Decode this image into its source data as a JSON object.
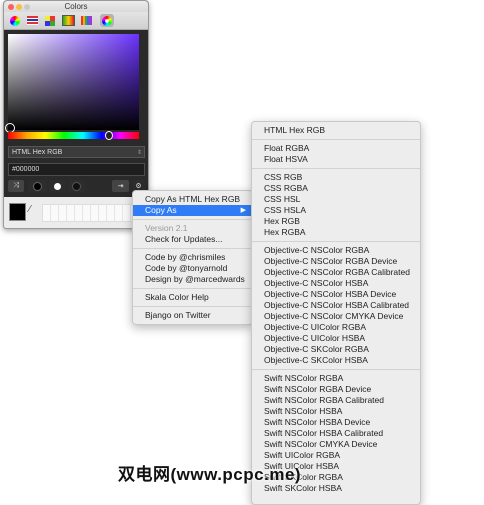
{
  "window": {
    "title": "Colors"
  },
  "toolbar": {
    "tools": [
      "color-wheel-icon",
      "color-sliders-icon",
      "color-palettes-icon",
      "image-palettes-icon",
      "pencils-icon",
      "skala-wheel-icon"
    ],
    "active": "skala-wheel-icon"
  },
  "picker": {
    "base_hue": "#6a32ff",
    "selected_color": "#000000"
  },
  "format_select": {
    "value": "HTML Hex RGB"
  },
  "hex_field": {
    "value": "#000000"
  },
  "context_menu": {
    "items": [
      {
        "label": "Copy As HTML Hex RGB"
      },
      {
        "label": "Copy As"
      },
      {
        "label": "Version 2.1"
      },
      {
        "label": "Check for Updates..."
      },
      {
        "label": "Code by @chrismiles"
      },
      {
        "label": "Code by @tonyarnold"
      },
      {
        "label": "Design by @marcedwards"
      },
      {
        "label": "Skala Color Help"
      },
      {
        "label": "Bjango on Twitter"
      }
    ]
  },
  "submenu": {
    "groups": [
      [
        "HTML Hex RGB"
      ],
      [
        "Float RGBA",
        "Float HSVA"
      ],
      [
        "CSS RGB",
        "CSS RGBA",
        "CSS HSL",
        "CSS HSLA",
        "Hex RGB",
        "Hex RGBA"
      ],
      [
        "Objective-C NSColor RGBA",
        "Objective-C NSColor RGBA Device",
        "Objective-C NSColor RGBA Calibrated",
        "Objective-C NSColor HSBA",
        "Objective-C NSColor HSBA Device",
        "Objective-C NSColor HSBA Calibrated",
        "Objective-C NSColor CMYKA Device",
        "Objective-C UIColor RGBA",
        "Objective-C UIColor HSBA",
        "Objective-C SKColor RGBA",
        "Objective-C SKColor HSBA"
      ],
      [
        "Swift NSColor RGBA",
        "Swift NSColor RGBA Device",
        "Swift NSColor RGBA Calibrated",
        "Swift NSColor HSBA",
        "Swift NSColor HSBA Device",
        "Swift NSColor HSBA Calibrated",
        "Swift NSColor CMYKA Device",
        "Swift UIColor RGBA",
        "Swift UIColor HSBA",
        "Swift SKColor RGBA",
        "Swift SKColor HSBA"
      ]
    ]
  },
  "watermark": "双电网(www.pcpc.me)",
  "colors": {
    "highlight": "#2f7cf6",
    "menu_bg": "#ededed"
  }
}
